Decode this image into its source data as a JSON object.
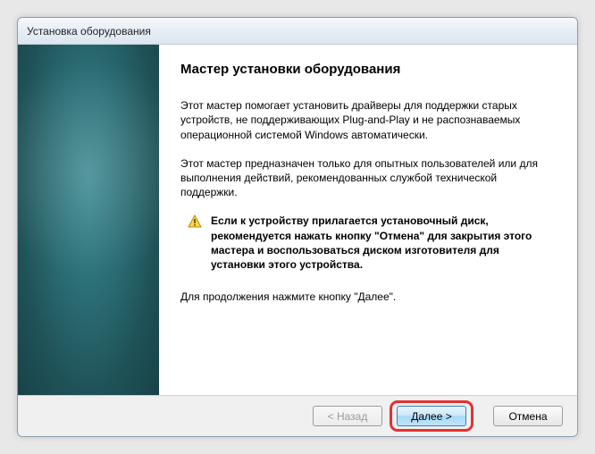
{
  "window": {
    "title": "Установка оборудования"
  },
  "wizard": {
    "heading": "Мастер установки оборудования",
    "para1": "Этот мастер помогает установить драйверы для поддержки старых устройств, не поддерживающих Plug-and-Play и не распознаваемых операционной системой Windows автоматически.",
    "para2": "Этот мастер предназначен только для опытных пользователей или для выполнения действий, рекомендованных службой технической поддержки.",
    "warning": "Если к устройству прилагается установочный диск, рекомендуется нажать кнопку \"Отмена\" для закрытия этого мастера и воспользоваться диском изготовителя для установки этого устройства.",
    "continue_hint": "Для продолжения нажмите кнопку \"Далее\"."
  },
  "buttons": {
    "back": "< Назад",
    "next": "Далее >",
    "cancel": "Отмена"
  }
}
